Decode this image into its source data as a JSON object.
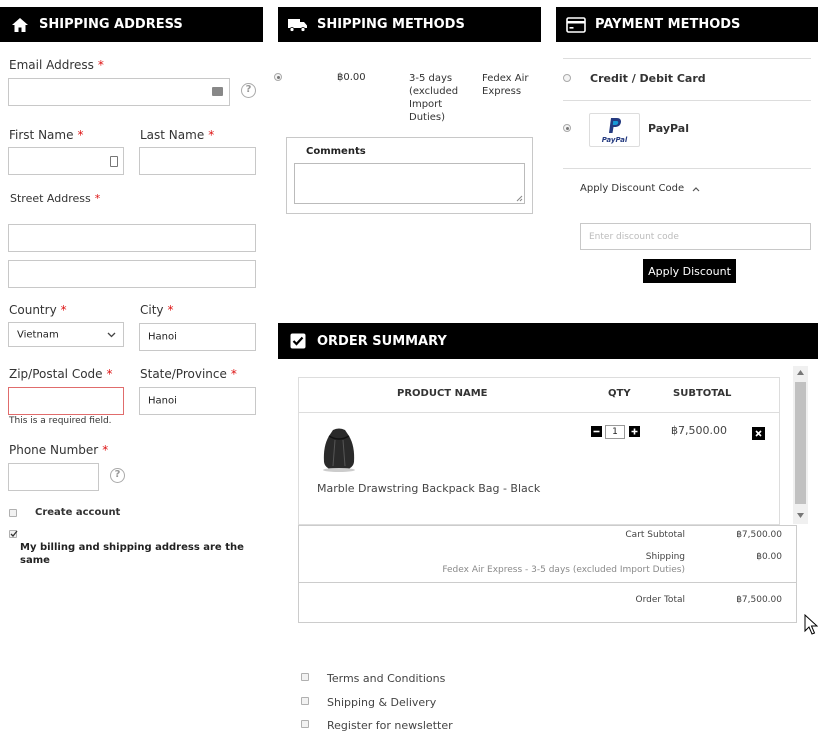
{
  "shipping_address": {
    "header": "SHIPPING ADDRESS",
    "email_label": "Email Address",
    "first_name_label": "First Name",
    "last_name_label": "Last Name",
    "street_label": "Street Address",
    "country_label": "Country",
    "country_value": "Vietnam",
    "city_label": "City",
    "city_value": "Hanoi",
    "zip_label": "Zip/Postal Code",
    "zip_error": "This is a required field.",
    "state_label": "State/Province",
    "state_value": "Hanoi",
    "phone_label": "Phone Number",
    "create_account": "Create account",
    "same_address": "My billing and shipping address are the same",
    "required_mark": "*",
    "help_mark": "?"
  },
  "shipping_methods": {
    "header": "SHIPPING METHODS",
    "price": "฿0.00",
    "eta": "3-5 days (excluded Import Duties)",
    "carrier": "Fedex Air Express",
    "comments_label": "Comments"
  },
  "payment_methods": {
    "header": "PAYMENT METHODS",
    "card_label": "Credit / Debit Card",
    "paypal_label": "PayPal",
    "paypal_logo": "PayPal",
    "discount_toggle": "Apply Discount Code",
    "discount_placeholder": "Enter discount code",
    "apply_button": "Apply Discount"
  },
  "order_summary": {
    "header": "ORDER SUMMARY",
    "columns": [
      "PRODUCT NAME",
      "QTY",
      "SUBTOTAL"
    ],
    "items": [
      {
        "name": "Marble Drawstring Backpack Bag - Black",
        "qty": "1",
        "subtotal": "฿7,500.00"
      }
    ],
    "cart_subtotal_label": "Cart Subtotal",
    "cart_subtotal_value": "฿7,500.00",
    "shipping_label": "Shipping",
    "shipping_value": "฿0.00",
    "shipping_detail": "Fedex Air Express - 3-5 days (excluded Import Duties)",
    "order_total_label": "Order Total",
    "order_total_value": "฿7,500.00"
  },
  "agreements": {
    "terms": "Terms and Conditions",
    "shipping_delivery": "Shipping & Delivery",
    "newsletter": "Register for newsletter"
  }
}
